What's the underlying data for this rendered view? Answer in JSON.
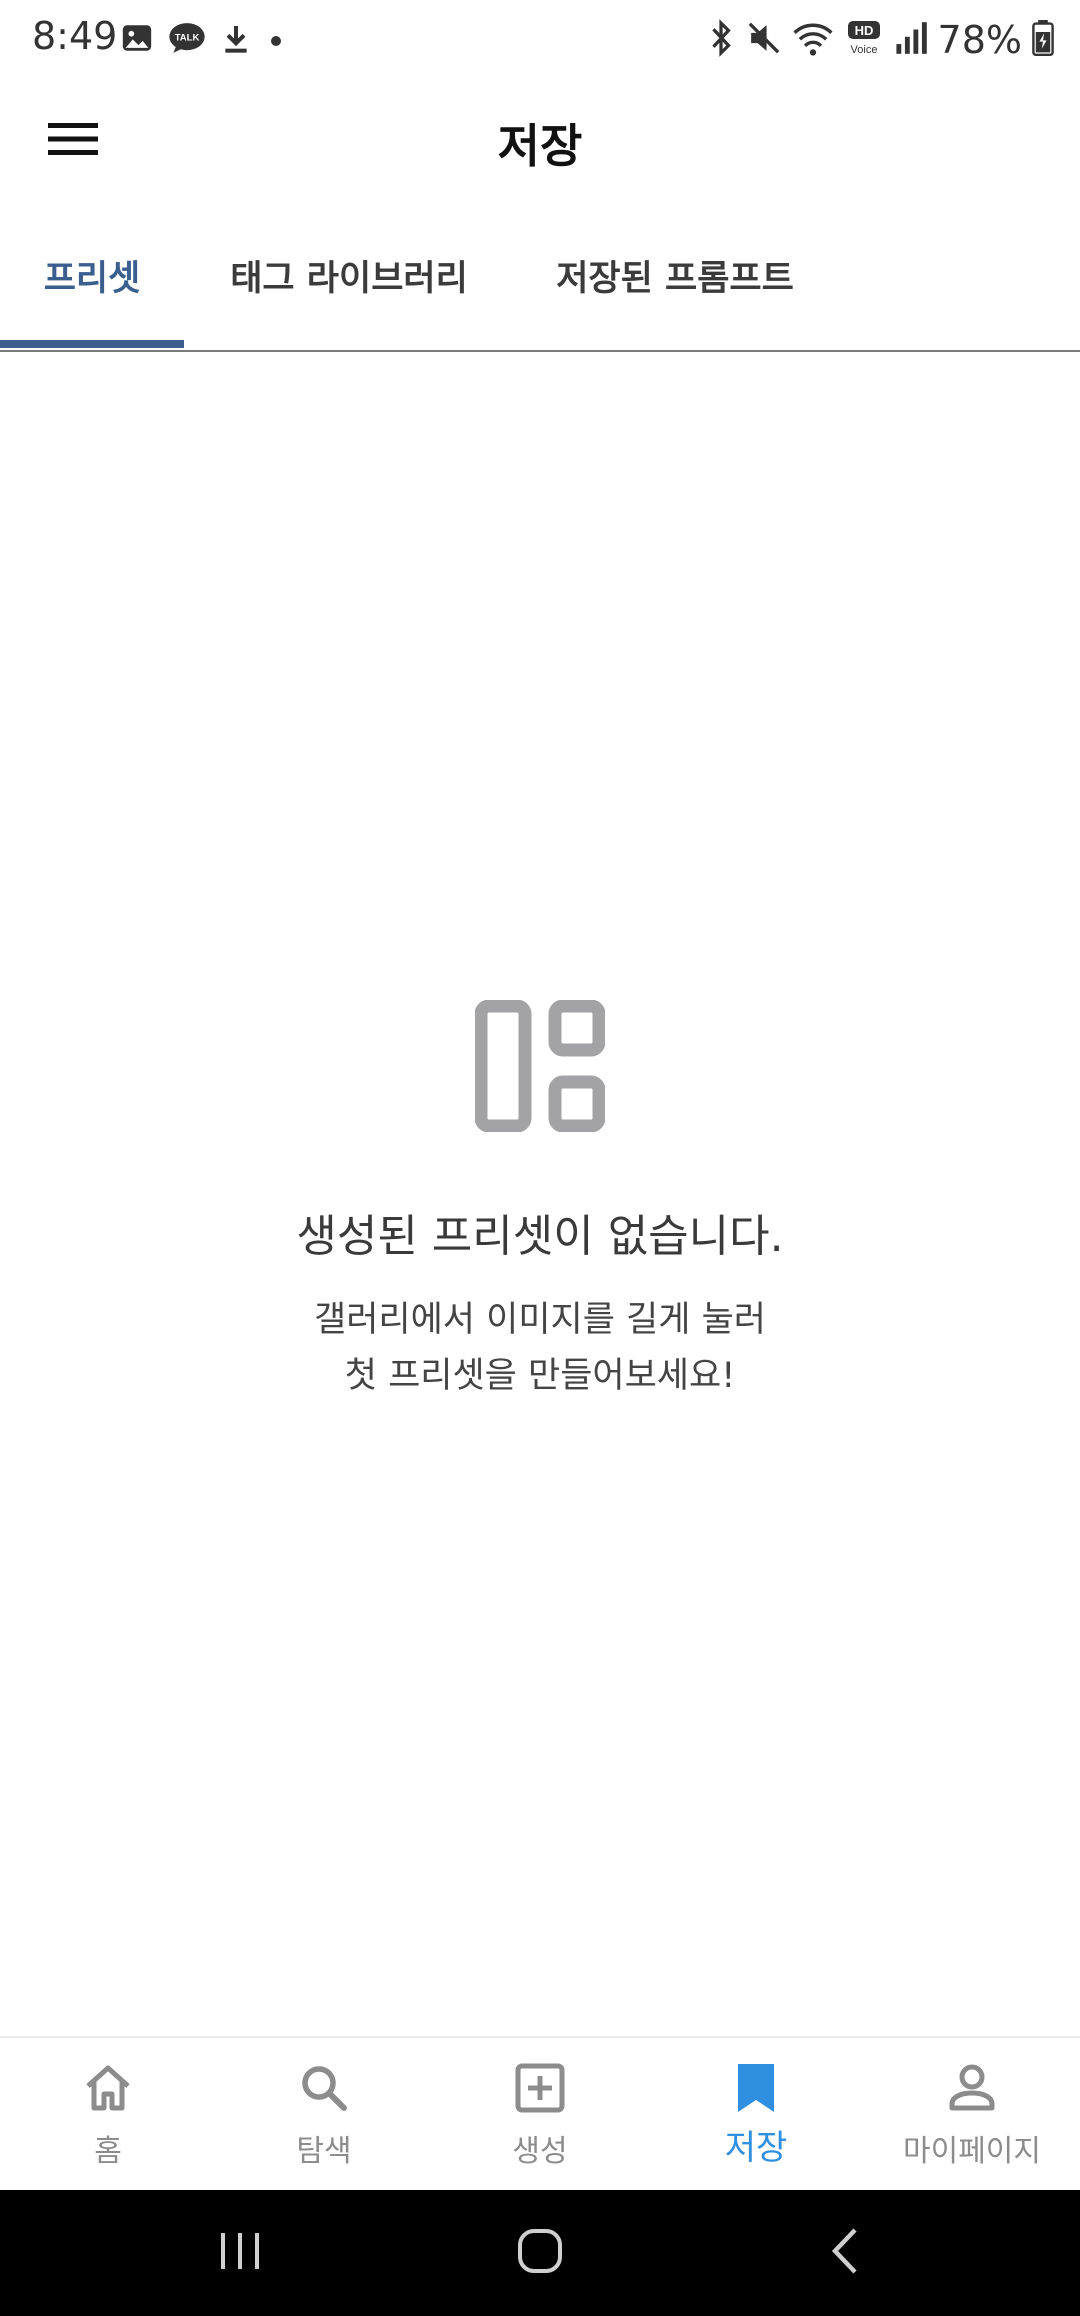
{
  "status_bar": {
    "time": "8:49",
    "battery": "78%",
    "left_icons": [
      "gallery-icon",
      "kakaotalk-icon",
      "download-icon",
      "dot-icon"
    ],
    "right_icons": [
      "bluetooth-icon",
      "mute-icon",
      "wifi-icon",
      "hd-voice-icon",
      "signal-icon",
      "battery-icon"
    ],
    "kakao_label": "TALK",
    "hd_label": "HD",
    "voice_label": "Voice"
  },
  "app_bar": {
    "title": "저장",
    "menu_icon": "hamburger-menu-icon"
  },
  "tabs": [
    {
      "label": "프리셋",
      "active": true
    },
    {
      "label": "태그 라이브러리",
      "active": false
    },
    {
      "label": "저장된 프롬프트",
      "active": false
    }
  ],
  "empty_state": {
    "icon": "dashboard-layout-icon",
    "title": "생성된 프리셋이 없습니다.",
    "desc_line1": "갤러리에서 이미지를 길게 눌러",
    "desc_line2": "첫 프리셋을 만들어보세요!"
  },
  "bottom_nav": [
    {
      "label": "홈",
      "icon": "home-icon",
      "active": false
    },
    {
      "label": "탐색",
      "icon": "search-icon",
      "active": false
    },
    {
      "label": "생성",
      "icon": "add-box-icon",
      "active": false
    },
    {
      "label": "저장",
      "icon": "bookmark-icon",
      "active": true
    },
    {
      "label": "마이페이지",
      "icon": "person-icon",
      "active": false
    }
  ],
  "colors": {
    "accent_tab": "#3a5f8f",
    "accent_nav": "#2f8fe0",
    "icon_gray": "#a3a3a6",
    "nav_gray": "#8c8c8c"
  }
}
